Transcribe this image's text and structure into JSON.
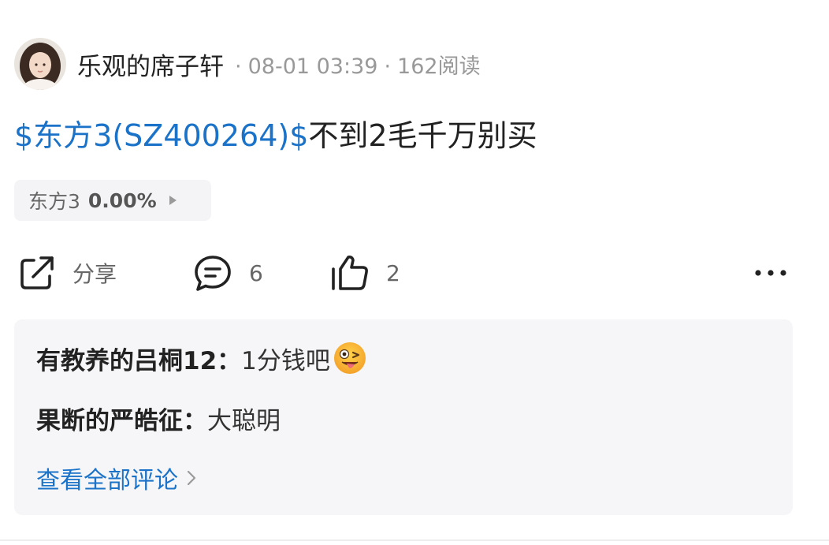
{
  "post": {
    "author": "乐观的席子轩",
    "separator": "·",
    "date": "08-01 03:39",
    "reads": "162阅读",
    "content_prefix": "$东方3(SZ400264)$",
    "content_text": "不到2毛千万别买"
  },
  "stock_chip": {
    "name": "东方3",
    "change": "0.00%"
  },
  "actions": {
    "share_label": "分享",
    "comment_count": "6",
    "like_count": "2"
  },
  "comments": [
    {
      "user": "有教养的吕桐12",
      "sep": "：",
      "text": "1分钱吧",
      "emoji": "winking-tongue-emoji"
    },
    {
      "user": "果断的严皓征",
      "sep": "：",
      "text": "大聪明"
    }
  ],
  "view_all_label": "查看全部评论",
  "colors": {
    "link_blue": "#1a73c9",
    "meta_gray": "#999999",
    "panel_bg": "#f6f6f8"
  }
}
